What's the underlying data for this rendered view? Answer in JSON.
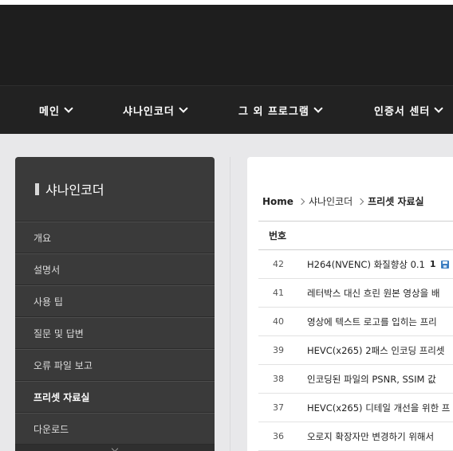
{
  "nav": {
    "items": [
      {
        "label": "메인"
      },
      {
        "label": "샤나인코더"
      },
      {
        "label": "그 외 프로그램"
      },
      {
        "label": "인증서 센터"
      }
    ]
  },
  "sidebar": {
    "title": "샤나인코더",
    "items": [
      {
        "label": "개요"
      },
      {
        "label": "설명서"
      },
      {
        "label": "사용 팁"
      },
      {
        "label": "질문 및 답변"
      },
      {
        "label": "오류 파일 보고"
      },
      {
        "label": "프리셋 자료실"
      },
      {
        "label": "다운로드"
      }
    ]
  },
  "breadcrumb": {
    "home": "Home",
    "section": "샤나인코더",
    "current": "프리셋 자료실"
  },
  "table": {
    "header_num": "번호",
    "rows": [
      {
        "num": "42",
        "title": "H264(NVENC) 화질향상 0.1",
        "count": "1",
        "icon": "disk-icon"
      },
      {
        "num": "41",
        "title": "레터박스 대신 흐린 원본 영상을 배"
      },
      {
        "num": "40",
        "title": "영상에 텍스트 로고를 입히는 프리"
      },
      {
        "num": "39",
        "title": "HEVC(x265) 2패스 인코딩 프리셋"
      },
      {
        "num": "38",
        "title": "인코딩된 파일의 PSNR, SSIM 값"
      },
      {
        "num": "37",
        "title": "HEVC(x265) 디테일 개선을 위한 프"
      },
      {
        "num": "36",
        "title": "오로지 확장자만 변경하기 위해서"
      }
    ]
  }
}
